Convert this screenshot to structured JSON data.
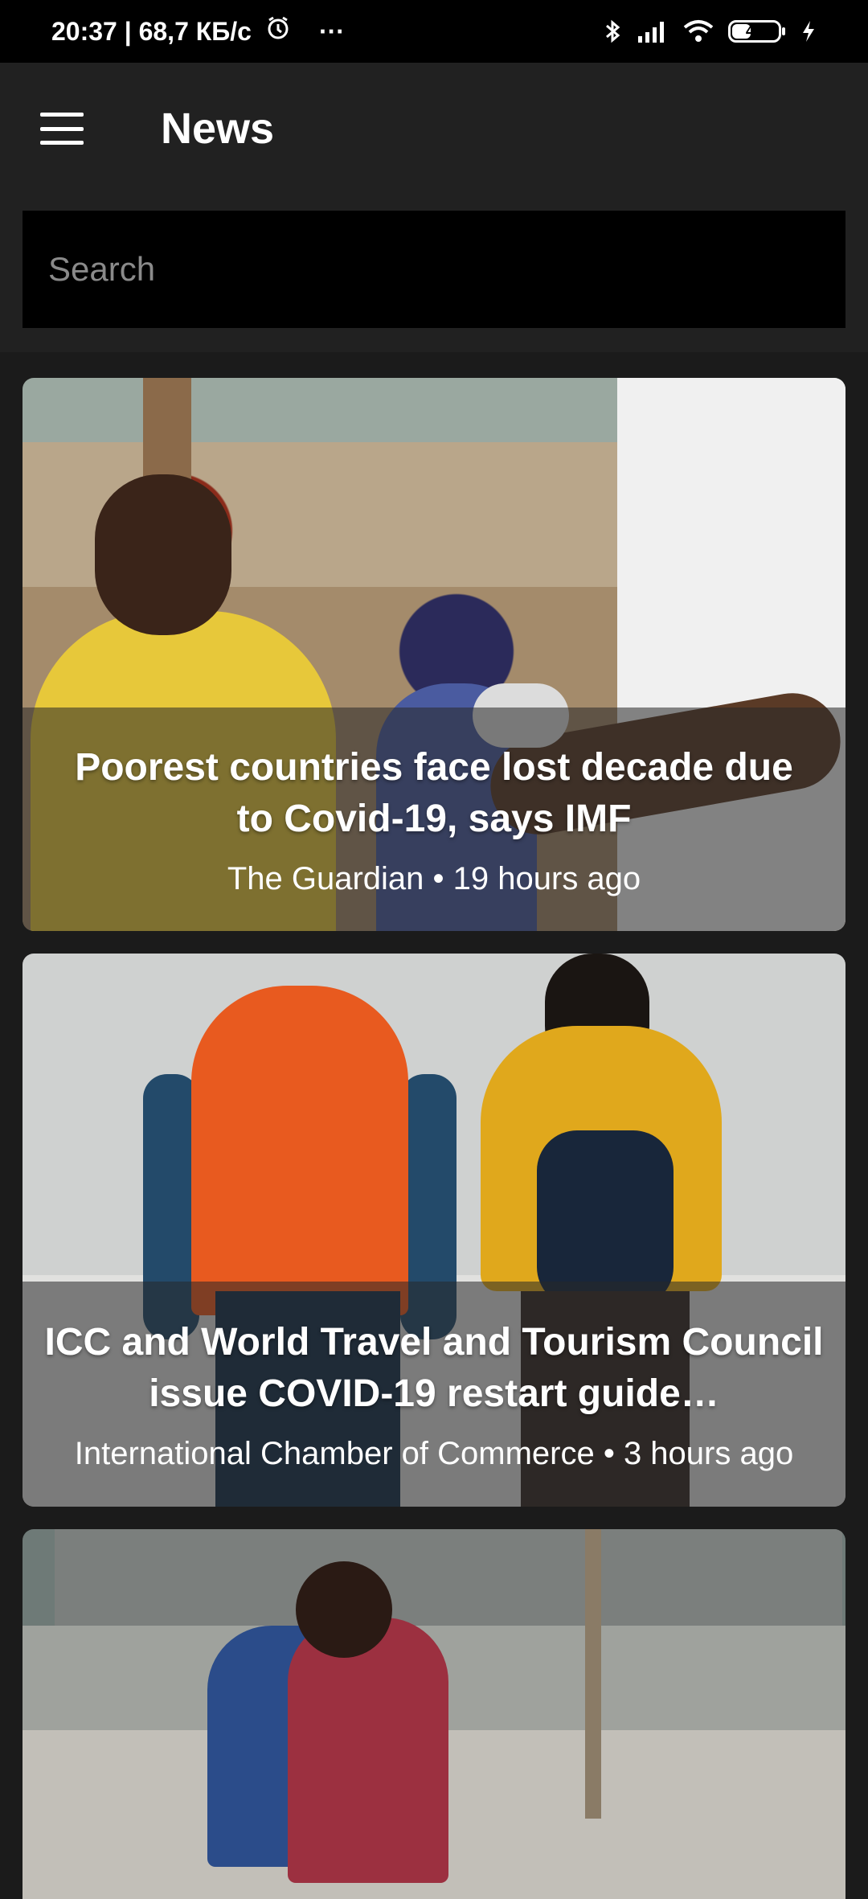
{
  "status_bar": {
    "time_speed": "20:37 | 68,7 КБ/с",
    "more": "···",
    "battery": "41"
  },
  "app_bar": {
    "title": "News"
  },
  "search": {
    "placeholder": "Search",
    "value": ""
  },
  "articles": [
    {
      "title": "Poorest countries face lost decade due to Covid-19, says IMF",
      "meta": "The Guardian • 19 hours ago"
    },
    {
      "title": "ICC and World Travel and Tourism Council issue COVID-19 restart guide…",
      "meta": "International Chamber of Commerce • 3 hours ago"
    },
    {
      "title": "",
      "meta": ""
    }
  ],
  "colors": {
    "background": "#1b1b1b",
    "app_bar": "#212121",
    "status_bar": "#000000",
    "search_field": "#000000"
  },
  "icons": [
    "alarm-icon",
    "bluetooth-icon",
    "signal-icon",
    "wifi-icon",
    "battery-icon",
    "charging-icon",
    "menu-icon"
  ]
}
